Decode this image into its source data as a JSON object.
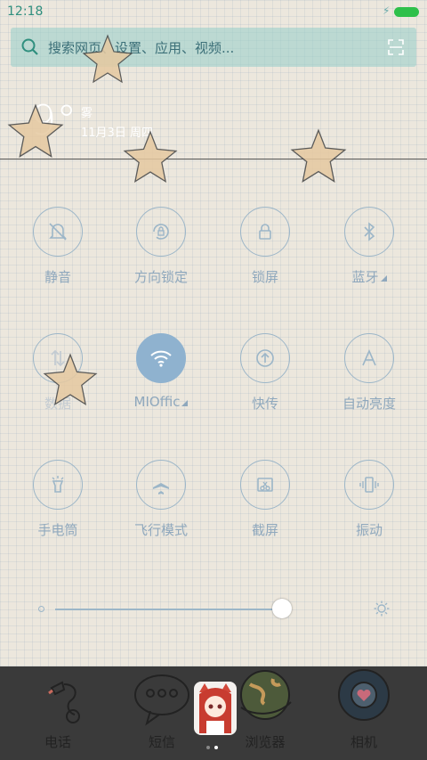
{
  "status": {
    "time": "12:18",
    "charging_icon": "bolt-icon"
  },
  "search": {
    "placeholder": "搜索网页、设置、应用、视频..."
  },
  "weather": {
    "temp": "9°",
    "condition": "雾",
    "date": "11月3日 周四"
  },
  "toggles": [
    {
      "label": "静音",
      "icon": "bell-off-icon"
    },
    {
      "label": "方向锁定",
      "icon": "rotation-lock-icon"
    },
    {
      "label": "锁屏",
      "icon": "lock-icon"
    },
    {
      "label": "蓝牙",
      "icon": "bluetooth-icon",
      "expand": true
    },
    {
      "label": "数据",
      "icon": "mobile-data-icon"
    },
    {
      "label": "MIOffic",
      "icon": "wifi-icon",
      "active": true,
      "expand": true
    },
    {
      "label": "快传",
      "icon": "quick-transfer-icon"
    },
    {
      "label": "自动亮度",
      "icon": "auto-brightness-icon"
    },
    {
      "label": "手电筒",
      "icon": "flashlight-icon"
    },
    {
      "label": "飞行模式",
      "icon": "airplane-icon"
    },
    {
      "label": "截屏",
      "icon": "screenshot-icon"
    },
    {
      "label": "振动",
      "icon": "vibrate-icon"
    }
  ],
  "brightness": {
    "level": 1.0
  },
  "dock": [
    {
      "label": "电话",
      "icon": "phone-icon"
    },
    {
      "label": "短信",
      "icon": "message-icon"
    },
    {
      "label": "浏览器",
      "icon": "browser-icon"
    },
    {
      "label": "相机",
      "icon": "camera-icon"
    }
  ],
  "colors": {
    "accent": "#8fb2cf",
    "dock": "#3a3a3a",
    "battery": "#2ec04a"
  }
}
